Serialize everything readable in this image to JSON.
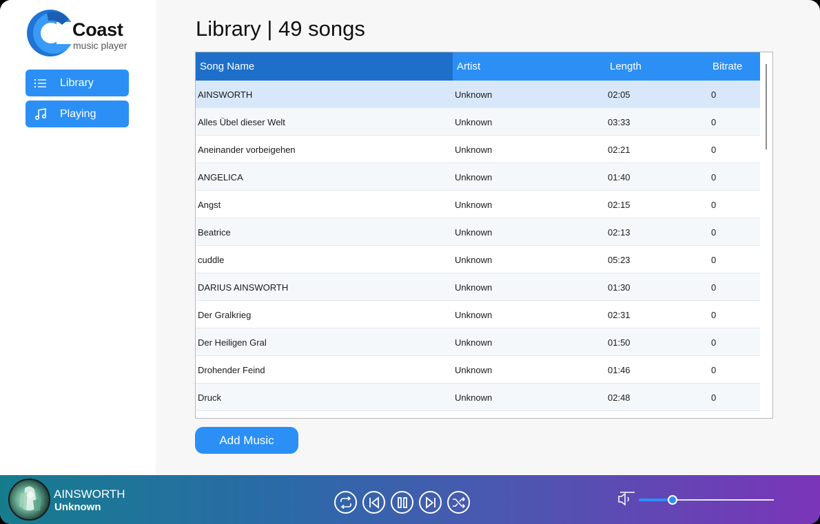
{
  "app": {
    "name": "Coast",
    "subtitle": "music player"
  },
  "sidebar": {
    "items": [
      {
        "label": "Library",
        "icon": "list-icon"
      },
      {
        "label": "Playing",
        "icon": "music-note-icon"
      }
    ]
  },
  "main": {
    "title": "Library | 49 songs",
    "table": {
      "columns": [
        "Song Name",
        "Artist",
        "Length",
        "Bitrate"
      ],
      "sorted_column": "Song Name",
      "rows": [
        {
          "name": "AINSWORTH",
          "artist": "Unknown",
          "length": "02:05",
          "bitrate": "0"
        },
        {
          "name": "Alles Übel dieser Welt",
          "artist": "Unknown",
          "length": "03:33",
          "bitrate": "0"
        },
        {
          "name": "Aneinander vorbeigehen",
          "artist": "Unknown",
          "length": "02:21",
          "bitrate": "0"
        },
        {
          "name": "ANGELICA",
          "artist": "Unknown",
          "length": "01:40",
          "bitrate": "0"
        },
        {
          "name": "Angst",
          "artist": "Unknown",
          "length": "02:15",
          "bitrate": "0"
        },
        {
          "name": "Beatrice",
          "artist": "Unknown",
          "length": "02:13",
          "bitrate": "0"
        },
        {
          "name": "cuddle",
          "artist": "Unknown",
          "length": "05:23",
          "bitrate": "0"
        },
        {
          "name": "DARIUS AINSWORTH",
          "artist": "Unknown",
          "length": "01:30",
          "bitrate": "0"
        },
        {
          "name": "Der Gralkrieg",
          "artist": "Unknown",
          "length": "02:31",
          "bitrate": "0"
        },
        {
          "name": "Der Heiligen Gral",
          "artist": "Unknown",
          "length": "01:50",
          "bitrate": "0"
        },
        {
          "name": "Drohender Feind",
          "artist": "Unknown",
          "length": "01:46",
          "bitrate": "0"
        },
        {
          "name": "Druck",
          "artist": "Unknown",
          "length": "02:48",
          "bitrate": "0"
        },
        {
          "name": "",
          "artist": "",
          "length": "",
          "bitrate": ""
        }
      ]
    },
    "add_button": "Add Music"
  },
  "player": {
    "title": "AINSWORTH",
    "artist": "Unknown",
    "controls": [
      "repeat-icon",
      "previous-icon",
      "pause-icon",
      "next-icon",
      "shuffle-icon"
    ],
    "volume_fraction": 0.25
  },
  "colors": {
    "accent": "#2b8ff5",
    "header_sorted": "#1e6fc9",
    "selected_row": "#d8e8fa",
    "player_gradient_start": "#157c8e",
    "player_gradient_end": "#7a35b8"
  }
}
